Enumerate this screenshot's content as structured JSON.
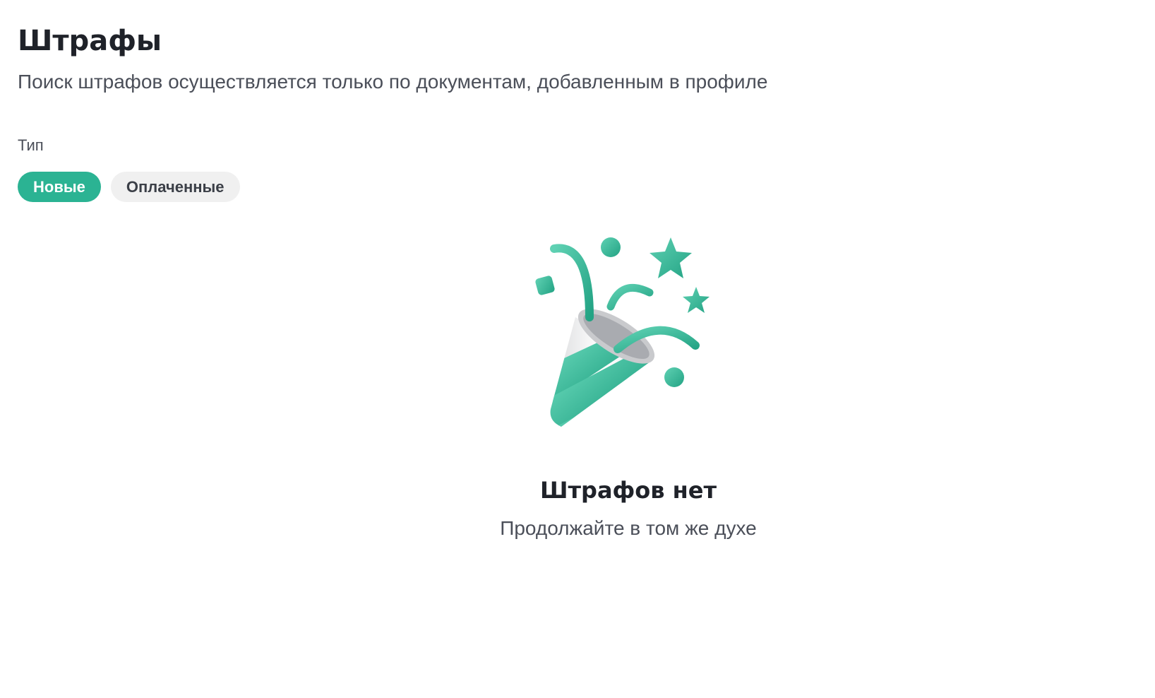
{
  "header": {
    "title": "Штрафы",
    "subtitle": "Поиск штрафов осуществляется только по документам, добавленным в профиле"
  },
  "filter": {
    "label": "Тип",
    "options": [
      {
        "label": "Новые",
        "selected": true
      },
      {
        "label": "Оплаченные",
        "selected": false
      }
    ]
  },
  "empty_state": {
    "icon": "party-popper-icon",
    "title": "Штрафов нет",
    "subtitle": "Продолжайте в том же духе"
  },
  "colors": {
    "accent": "#2bb393",
    "chip_inactive_bg": "#f0f0f0",
    "text_primary": "#1f2229",
    "text_secondary": "#4b4f59"
  }
}
